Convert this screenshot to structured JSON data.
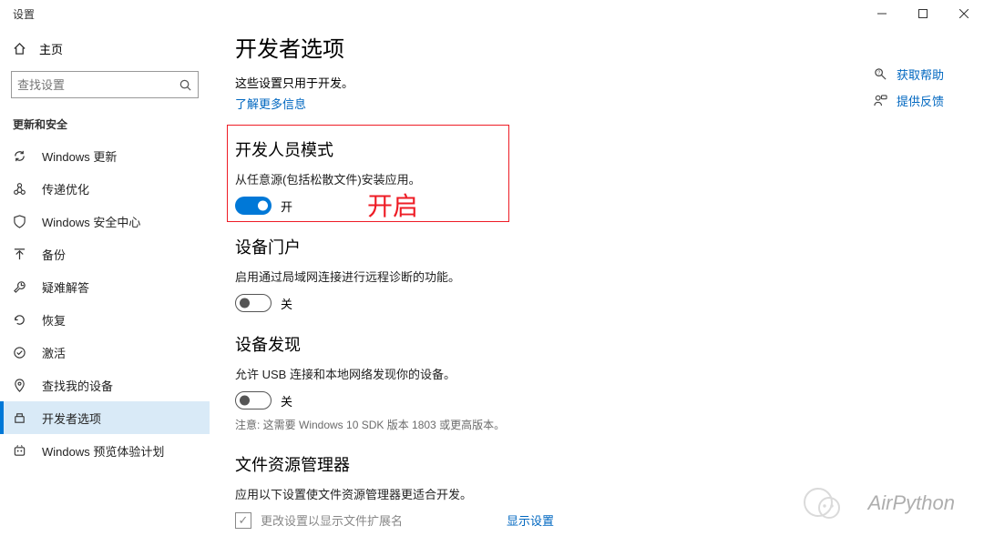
{
  "window": {
    "title": "设置"
  },
  "home": {
    "label": "主页"
  },
  "search": {
    "placeholder": "查找设置"
  },
  "category": "更新和安全",
  "nav": [
    {
      "key": "update",
      "label": "Windows 更新"
    },
    {
      "key": "delivery",
      "label": "传递优化"
    },
    {
      "key": "security",
      "label": "Windows 安全中心"
    },
    {
      "key": "backup",
      "label": "备份"
    },
    {
      "key": "troubleshoot",
      "label": "疑难解答"
    },
    {
      "key": "recovery",
      "label": "恢复"
    },
    {
      "key": "activation",
      "label": "激活"
    },
    {
      "key": "findmydev",
      "label": "查找我的设备"
    },
    {
      "key": "developer",
      "label": "开发者选项",
      "selected": true
    },
    {
      "key": "insider",
      "label": "Windows 预览体验计划"
    }
  ],
  "page": {
    "title": "开发者选项",
    "subtitle": "这些设置只用于开发。",
    "learn_more": "了解更多信息"
  },
  "dev_mode": {
    "heading": "开发人员模式",
    "desc": "从任意源(包括松散文件)安装应用。",
    "state_label": "开",
    "annotation": "开启"
  },
  "device_portal": {
    "heading": "设备门户",
    "desc": "启用通过局域网连接进行远程诊断的功能。",
    "state_label": "关"
  },
  "device_discovery": {
    "heading": "设备发现",
    "desc": "允许 USB 连接和本地网络发现你的设备。",
    "state_label": "关",
    "note": "注意: 这需要 Windows 10 SDK 版本 1803 或更高版本。"
  },
  "file_explorer": {
    "heading": "文件资源管理器",
    "desc": "应用以下设置使文件资源管理器更适合开发。",
    "items": [
      {
        "label": "更改设置以显示文件扩展名",
        "link": "显示设置"
      }
    ]
  },
  "right": {
    "help": "获取帮助",
    "feedback": "提供反馈"
  },
  "watermark": "AirPython"
}
